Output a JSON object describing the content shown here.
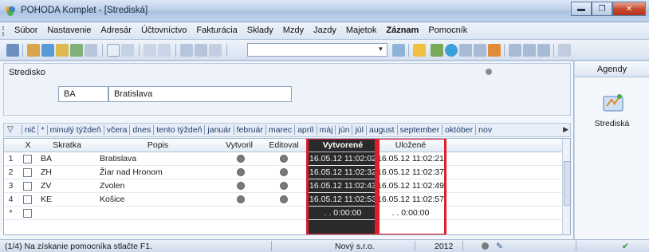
{
  "window": {
    "title": "POHODA Komplet - [Strediská]",
    "buttons": {
      "minimize": "▬",
      "maximize": "❐",
      "close": "✕"
    }
  },
  "menu": {
    "items": [
      "Súbor",
      "Nastavenie",
      "Adresár",
      "Účtovníctvo",
      "Fakturácia",
      "Sklady",
      "Mzdy",
      "Jazdy",
      "Majetok",
      "Záznam",
      "Pomocník"
    ],
    "bold_item": "Záznam"
  },
  "form": {
    "section_label": "Stredisko",
    "code_value": "BA",
    "name_value": "Bratislava"
  },
  "filters": {
    "items": [
      "nič",
      "*",
      "minulý týždeň",
      "včera",
      "dnes",
      "tento týždeň",
      "január",
      "február",
      "marec",
      "apríl",
      "máj",
      "jún",
      "júl",
      "august",
      "september",
      "október",
      "nov"
    ]
  },
  "grid": {
    "columns": {
      "x": "X",
      "skratka": "Skratka",
      "popis": "Popis",
      "vytvoril": "Vytvoril",
      "editoval": "Editoval",
      "vytvorene": "Vytvorené",
      "ulozene": "Uložené"
    },
    "rows": [
      {
        "num": "1",
        "skratka": "BA",
        "popis": "Bratislava",
        "vytvorene": "16.05.12 11:02:02",
        "ulozene": "16.05.12 11:02:21"
      },
      {
        "num": "2",
        "skratka": "ZH",
        "popis": "Žiar nad Hronom",
        "vytvorene": "16.05.12 11:02:32",
        "ulozene": "16.05.12 11:02:37"
      },
      {
        "num": "3",
        "skratka": "ZV",
        "popis": "Zvolen",
        "vytvorene": "16.05.12 11:02:43",
        "ulozene": "16.05.12 11:02:49"
      },
      {
        "num": "4",
        "skratka": "KE",
        "popis": "Košice",
        "vytvorene": "16.05.12 11:02:53",
        "ulozene": "16.05.12 11:02:57"
      }
    ],
    "new_row": {
      "num": "*",
      "vytvorene": ". . 0:00:00",
      "ulozene": ". . 0:00:00"
    }
  },
  "agenda": {
    "header": "Agendy",
    "item_label": "Strediská"
  },
  "status": {
    "hint": "(1/4) Na získanie pomocníka stlačte F1.",
    "company": "Nový s.r.o.",
    "year": "2012"
  },
  "colors": {
    "highlight_box": "#e01e2a",
    "created_column_bg": "#2a2a2a"
  }
}
